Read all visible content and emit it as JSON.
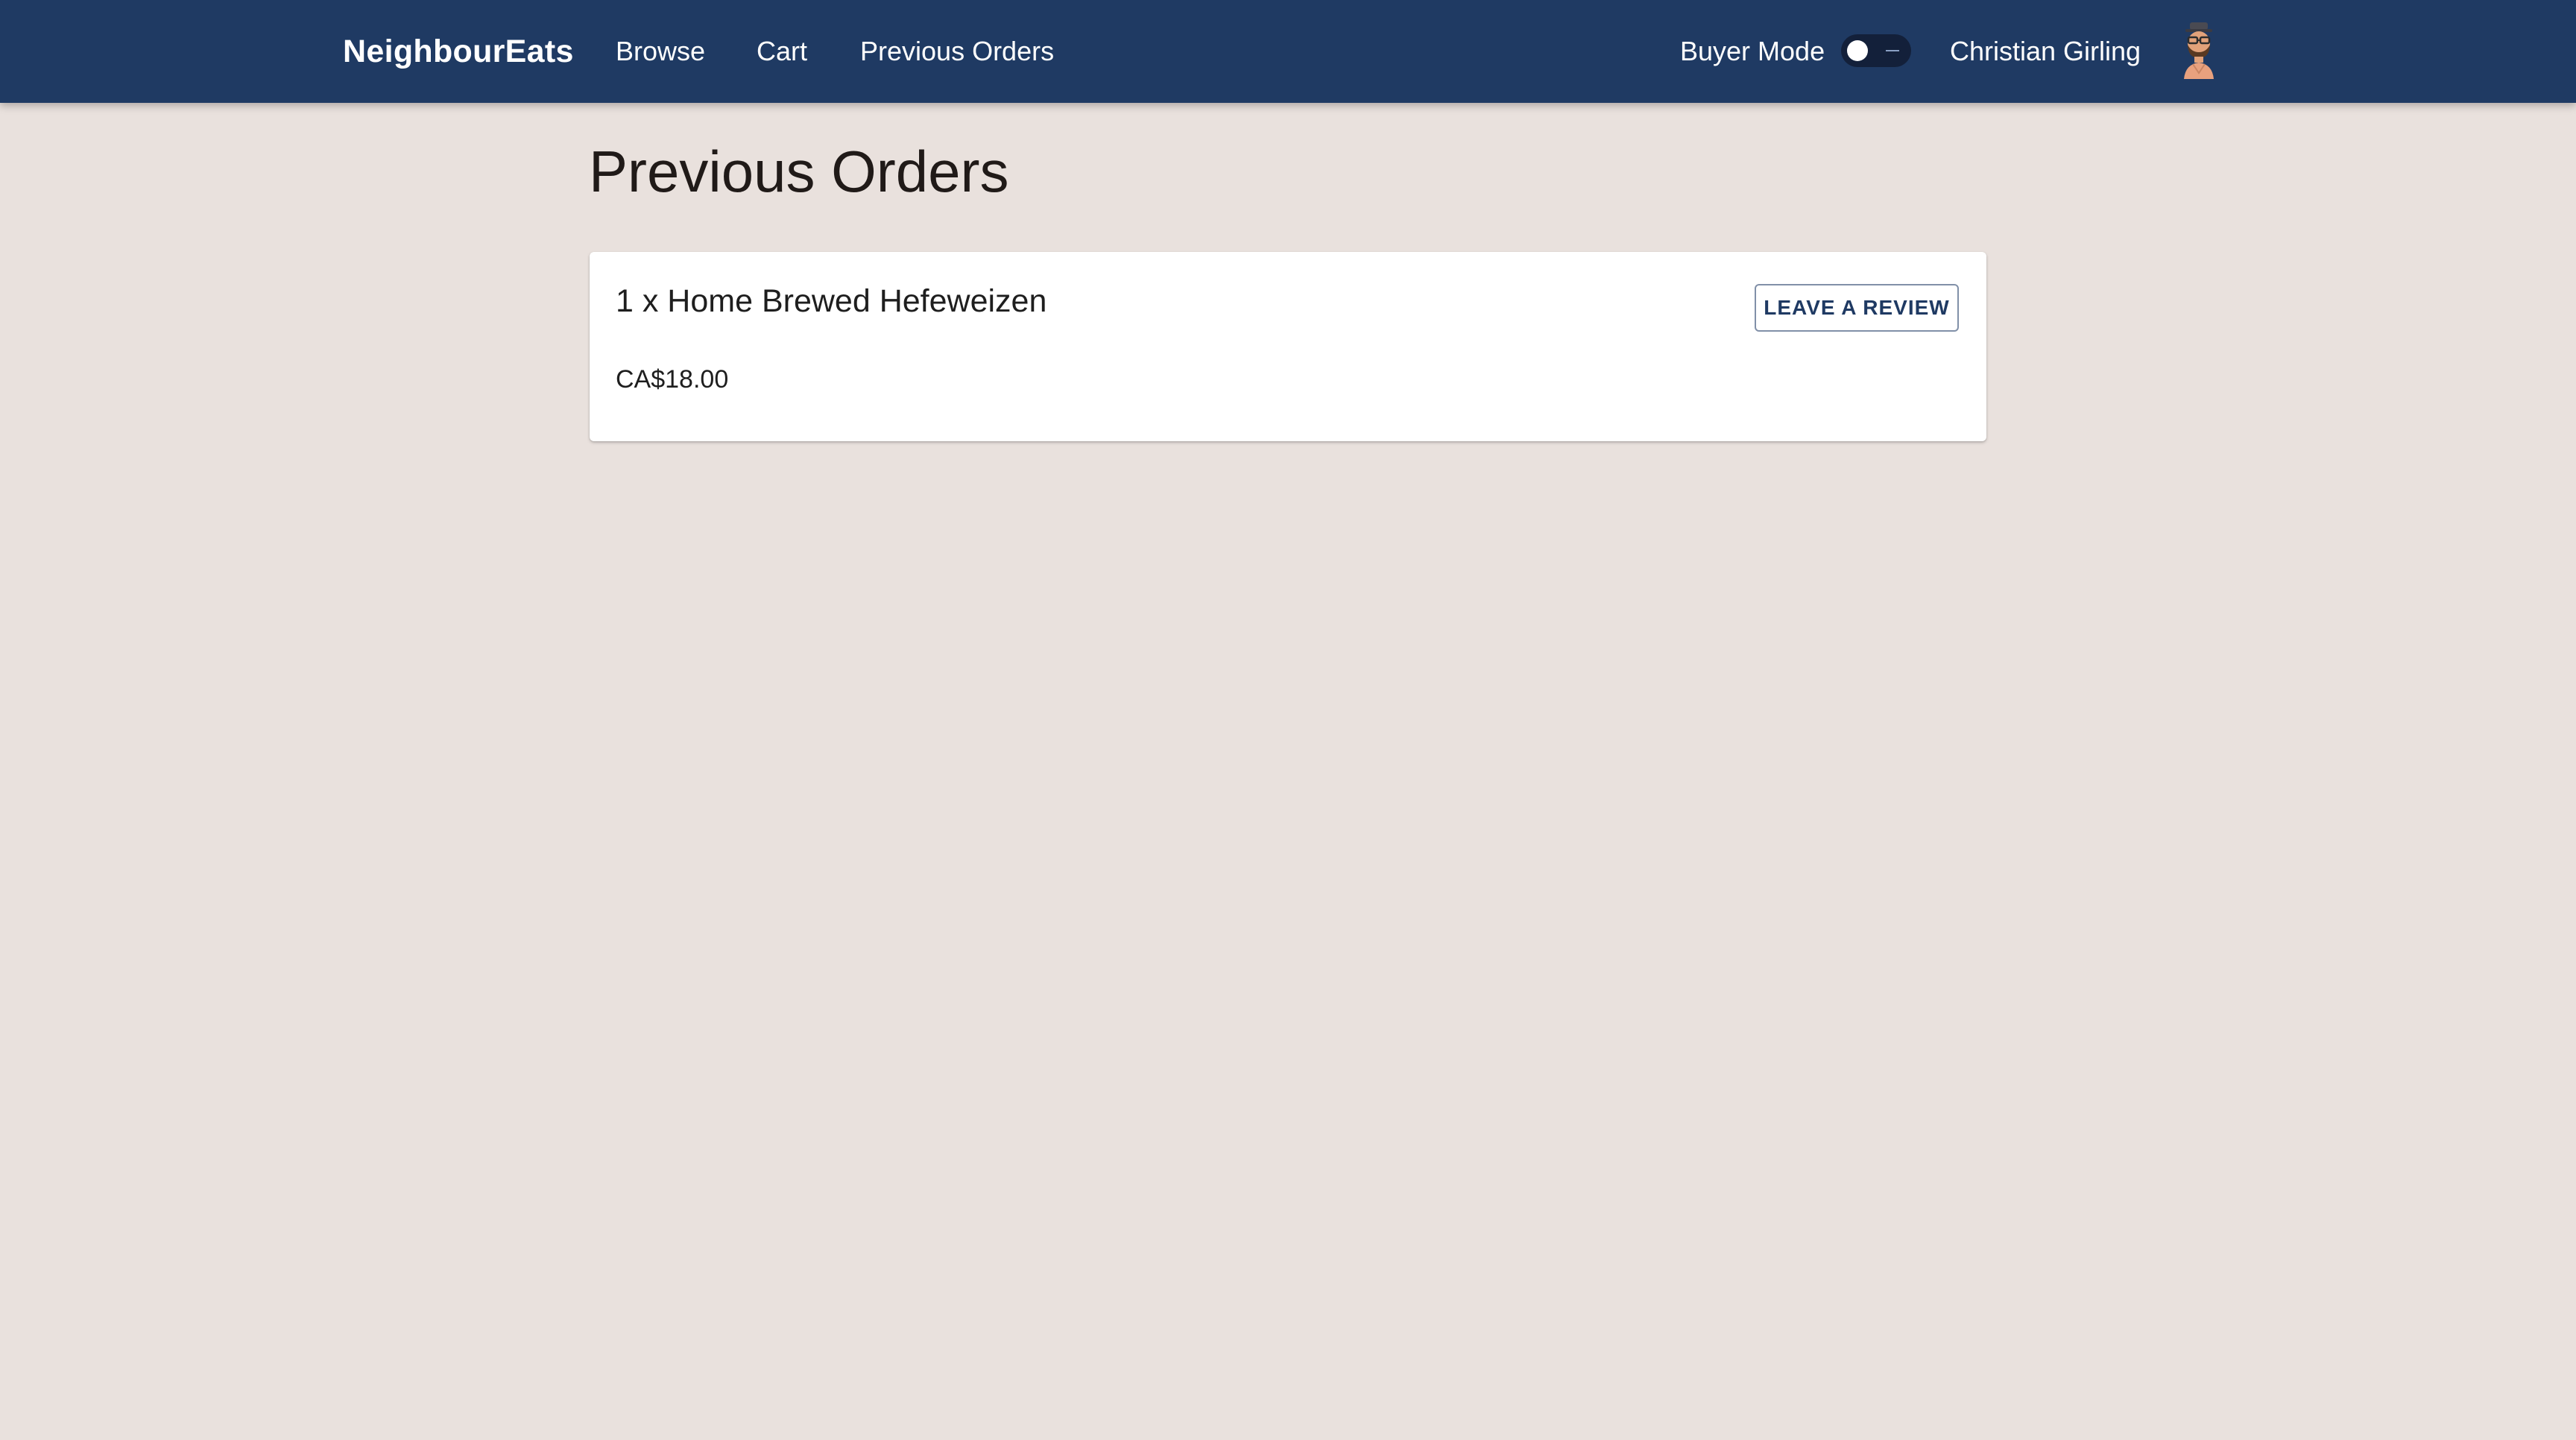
{
  "app": {
    "brand": "NeighbourEats"
  },
  "nav": {
    "links": [
      {
        "label": "Browse"
      },
      {
        "label": "Cart"
      },
      {
        "label": "Previous Orders"
      }
    ],
    "mode_label": "Buyer Mode",
    "mode_toggle_on": false,
    "user_name": "Christian Girling",
    "avatar_icon": "user-avatar-icon"
  },
  "page": {
    "title": "Previous Orders"
  },
  "orders": [
    {
      "title": "1 x Home Brewed Hefeweizen",
      "price": "CA$18.00",
      "review_button_label": "LEAVE A REVIEW"
    }
  ],
  "colors": {
    "navbar": "#1f3a63",
    "background": "#e9e1dd",
    "card": "#ffffff",
    "accent": "#1f3a63"
  }
}
